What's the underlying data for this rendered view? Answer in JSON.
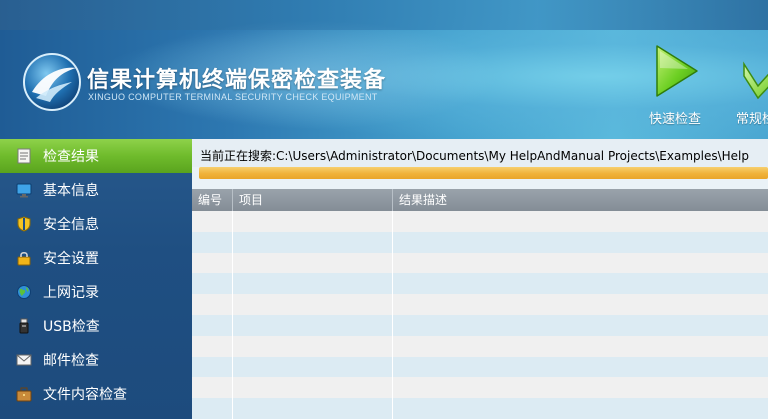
{
  "header": {
    "title": "信果计算机终端保密检查装备",
    "subtitle": "XINGUO COMPUTER TERMINAL SECURITY CHECK EQUIPMENT",
    "toolbar": [
      {
        "label": "快速检查",
        "icon": "play-icon"
      },
      {
        "label": "常规检",
        "icon": "check-icon"
      }
    ]
  },
  "sidebar": {
    "items": [
      {
        "label": "检查结果",
        "icon": "result-list-icon",
        "active": true
      },
      {
        "label": "基本信息",
        "icon": "monitor-icon"
      },
      {
        "label": "安全信息",
        "icon": "shield-icon"
      },
      {
        "label": "安全设置",
        "icon": "lock-icon"
      },
      {
        "label": "上网记录",
        "icon": "globe-icon"
      },
      {
        "label": "USB检查",
        "icon": "usb-icon"
      },
      {
        "label": "邮件检查",
        "icon": "mail-icon"
      },
      {
        "label": "文件内容检查",
        "icon": "briefcase-icon"
      }
    ]
  },
  "main": {
    "search_status": "当前正在搜索:C:\\Users\\Administrator\\Documents\\My HelpAndManual Projects\\Examples\\Help",
    "progress_fraction": 1.0,
    "table": {
      "columns": [
        "编号",
        "项目",
        "结果描述"
      ],
      "row_count": 10
    }
  },
  "colors": {
    "accent_green": "#6fbb2c",
    "progress_orange": "#f0b23a",
    "sidebar_blue": "#1f4f82",
    "row_blue": "#dcebf3"
  }
}
